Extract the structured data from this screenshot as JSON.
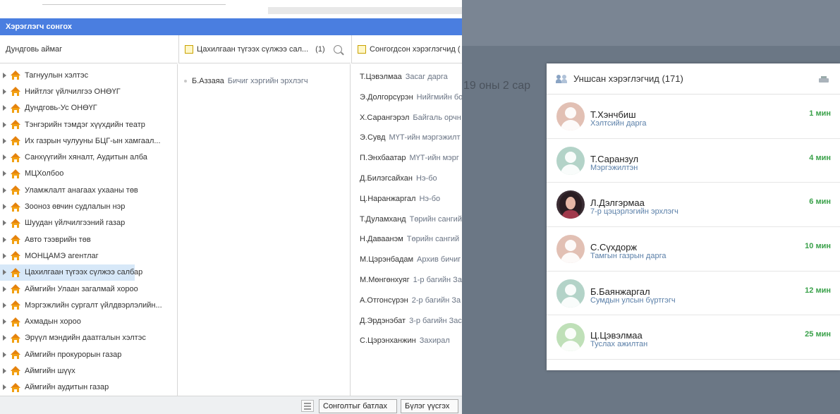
{
  "dialog": {
    "title": "Хэрэглэгч сонгох",
    "columns": {
      "orgs": {
        "header": "Дундговь аймаг"
      },
      "members": {
        "header": "Цахилгаан түгээх сүлжээ сал...",
        "count": "(1)"
      },
      "selected": {
        "header": "Сонгогдсон хэрэглэгчид ("
      }
    },
    "orgs": [
      "Тагнуулын хэлтэс",
      "Нийтлэг үйлчилгээ ОНӨҮГ",
      "Дундговь-Ус ОНӨҮГ",
      "Тэнгэрийн тэмдэг хүүхдийн театр",
      "Их газрын чулууны БЦГ-ын хамгаал...",
      "Санхүүгийн хяналт, Аудитын алба",
      "МЦХолбоо",
      "Уламжлалт анагаах ухааны төв",
      "Зооноз өвчин судлалын нэр",
      "Шуудан үйлчилгээний газар",
      "Авто тээврийн төв",
      "МОНЦАМЭ агентлаг",
      "Цахилгаан түгээх сүлжээ салбар",
      "Аймгийн Улаан загалмай хороо",
      "Мэргэжлийн сургалт үйлдвэрлэлийн...",
      "Ахмадын хороо",
      "Эрүүл мэндийн даатгалын хэлтэс",
      "Аймгийн прокурорын газар",
      "Аймгийн шүүх",
      "Аймгийн аудитын газар"
    ],
    "selected_org": "Цахилгаан түгээх сүлжээ салбар",
    "member": {
      "name": "Б.Аззаяа",
      "role": "Бичиг хэргийн эрхлэгч"
    },
    "selected_users": [
      {
        "name": "Т.Цэвэлмаа",
        "role": "Засаг дарга"
      },
      {
        "name": "Э.Долгорсүрэн",
        "role": "Нийгмийн бо"
      },
      {
        "name": "Х.Сарангэрэл",
        "role": "Байгаль орчн"
      },
      {
        "name": "Э.Сувд",
        "role": "МҮТ-ийн мэргэжилт"
      },
      {
        "name": "П.Энхбаатар",
        "role": "МҮТ-ийн мэрг"
      },
      {
        "name": "Д.Билэгсайхан",
        "role": "Нэ-бо"
      },
      {
        "name": "Ц.Наранжаргал",
        "role": "Нэ-бо"
      },
      {
        "name": "Т.Дуламханд",
        "role": "Төрийн сангий"
      },
      {
        "name": "Н.Даваанэм",
        "role": "Төрийн сангий"
      },
      {
        "name": "М.Цэрэнбадам",
        "role": "Архив бичиг"
      },
      {
        "name": "М.Мөнгөнхуяг",
        "role": "1-р багийн За"
      },
      {
        "name": "А.Отгонсүрэн",
        "role": "2-р багийн За"
      },
      {
        "name": "Д.Эрдэнэбат",
        "role": "3-р багийн Зас"
      },
      {
        "name": "С.Цэрэнханжин",
        "role": "Захирал"
      }
    ],
    "footer": {
      "confirm": "Сонголтыг батлах",
      "group": "Бүлэг үүсгэх"
    }
  },
  "background": {
    "text": "19 оны 2 сар"
  },
  "online": {
    "title": "Уншсан хэрэглэгчид (171)",
    "users": [
      {
        "name": "Т.Хэнчбиш",
        "title": "Хэлтсийн дарга",
        "time": "1 мин",
        "avatar": "placeholder",
        "color": "#e2c0b4"
      },
      {
        "name": "Т.Саранзул",
        "title": "Мэргэжилтэн",
        "time": "4 мин",
        "avatar": "placeholder",
        "color": "#b3d3c8"
      },
      {
        "name": "Л.Дэлгэрмаа",
        "title": "7-р цэцэрлэгийн эрхлэгч",
        "time": "6 мин",
        "avatar": "photo",
        "color": "#3a2c33"
      },
      {
        "name": "С.Сүхдорж",
        "title": "Тамгын газрын дарга",
        "time": "10 мин",
        "avatar": "placeholder",
        "color": "#e2c0b4"
      },
      {
        "name": "Б.Баянжаргал",
        "title": "Сумдын улсын бүртгэгч",
        "time": "12 мин",
        "avatar": "placeholder",
        "color": "#b3d3c8"
      },
      {
        "name": "Ц.Цэвэлмаа",
        "title": "Туслах ажилтан",
        "time": "25 мин",
        "avatar": "placeholder",
        "color": "#bfe0b8"
      }
    ]
  }
}
